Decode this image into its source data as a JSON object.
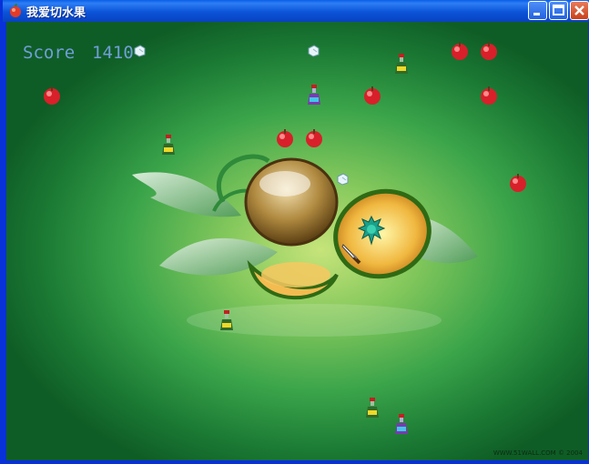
{
  "window": {
    "title": "我爱切水果",
    "buttons": {
      "minimize": "minimize",
      "maximize": "maximize",
      "close": "close"
    }
  },
  "hud": {
    "score_label": "Score",
    "score_value": "1410"
  },
  "watermark": "WWW.51WALL.COM © 2004",
  "items": {
    "apple": "apple-icon",
    "potion_yellow": "yellow-potion-icon",
    "potion_purple": "purple-potion-icon",
    "ice_cube": "ice-cube-icon",
    "cactus": "cactus-bomb-icon",
    "knife": "knife-cursor-icon"
  },
  "colors": {
    "title_bar": "#0b54d8",
    "score_text": "#6f9fd8",
    "background_center": "#c6e47a",
    "background_edge": "#0f5d26"
  }
}
